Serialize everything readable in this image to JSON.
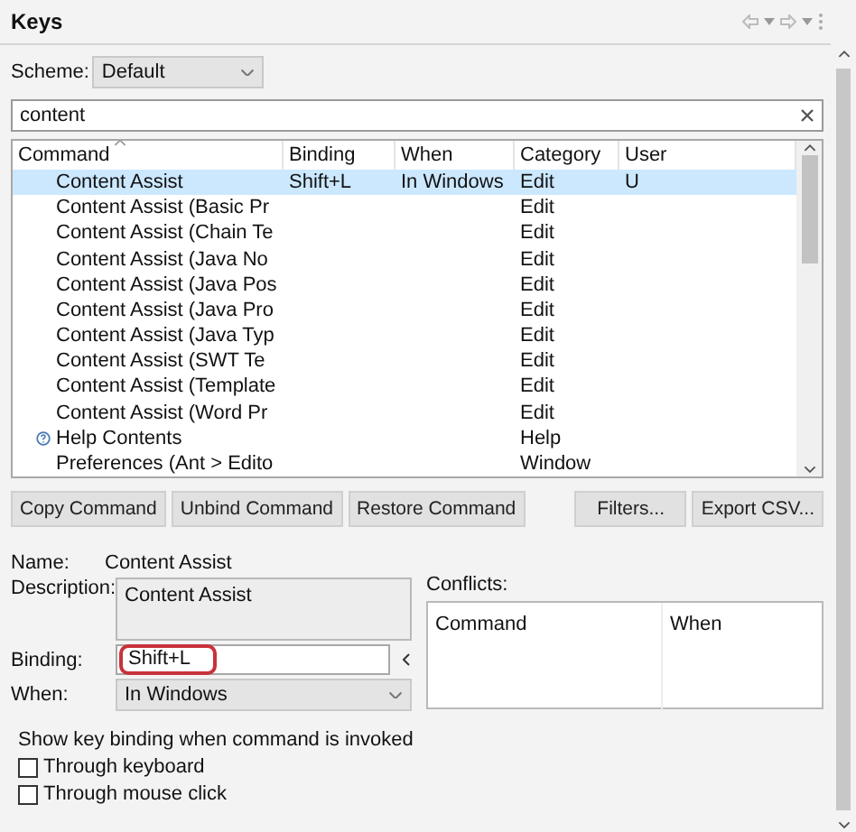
{
  "view": {
    "title": "Keys"
  },
  "scheme": {
    "label": "Scheme:",
    "value": "Default"
  },
  "filter": {
    "value": "content"
  },
  "table": {
    "columns": [
      "Command",
      "Binding",
      "When",
      "Category",
      "User"
    ],
    "rows": [
      {
        "kind": "command",
        "command": "Content Assist",
        "binding": "Shift+L",
        "when": "In Windows",
        "category": "Edit",
        "user": "U",
        "selected": true
      },
      {
        "kind": "command",
        "command": "Content Assist (Basic Pr",
        "category": "Edit",
        "selected": false
      },
      {
        "kind": "command",
        "command": "Content Assist (Chain Te",
        "category": "Edit",
        "selected": false
      },
      {
        "kind": "command",
        "command": "Content Assist (Java No",
        "category": "Edit",
        "selected": false
      },
      {
        "kind": "command",
        "command": "Content Assist (Java Pos",
        "category": "Edit",
        "selected": false
      },
      {
        "kind": "command",
        "command": "Content Assist (Java Pro",
        "category": "Edit",
        "selected": false
      },
      {
        "kind": "command",
        "command": "Content Assist (Java Typ",
        "category": "Edit",
        "selected": false
      },
      {
        "kind": "command",
        "command": "Content Assist (SWT Te",
        "category": "Edit",
        "selected": false
      },
      {
        "kind": "command",
        "command": "Content Assist (Template",
        "category": "Edit",
        "selected": false
      },
      {
        "kind": "command",
        "command": "Content Assist (Word Pr",
        "category": "Edit",
        "selected": false
      },
      {
        "kind": "help",
        "command": "Help Contents",
        "category": "Help",
        "selected": false
      },
      {
        "kind": "command",
        "command": "Preferences (Ant > Edito",
        "category": "Window",
        "selected": false
      }
    ]
  },
  "buttons_left": [
    "Copy Command",
    "Unbind Command",
    "Restore Command"
  ],
  "buttons_right": [
    "Filters...",
    "Export CSV..."
  ],
  "details": {
    "name_label": "Name:",
    "name": "Content Assist",
    "description_label": "Description:",
    "description": "Content Assist",
    "binding_label": "Binding:",
    "binding": "Shift+L",
    "binding_highlighted": true,
    "when_label": "When:",
    "when": "In Windows"
  },
  "conflicts": {
    "label": "Conflicts:",
    "columns": [
      "Command",
      "When"
    ]
  },
  "show_binding": {
    "label": "Show key binding when command is invoked",
    "options": [
      {
        "label": "Through keyboard",
        "checked": false
      },
      {
        "label": "Through mouse click",
        "checked": false
      }
    ]
  }
}
